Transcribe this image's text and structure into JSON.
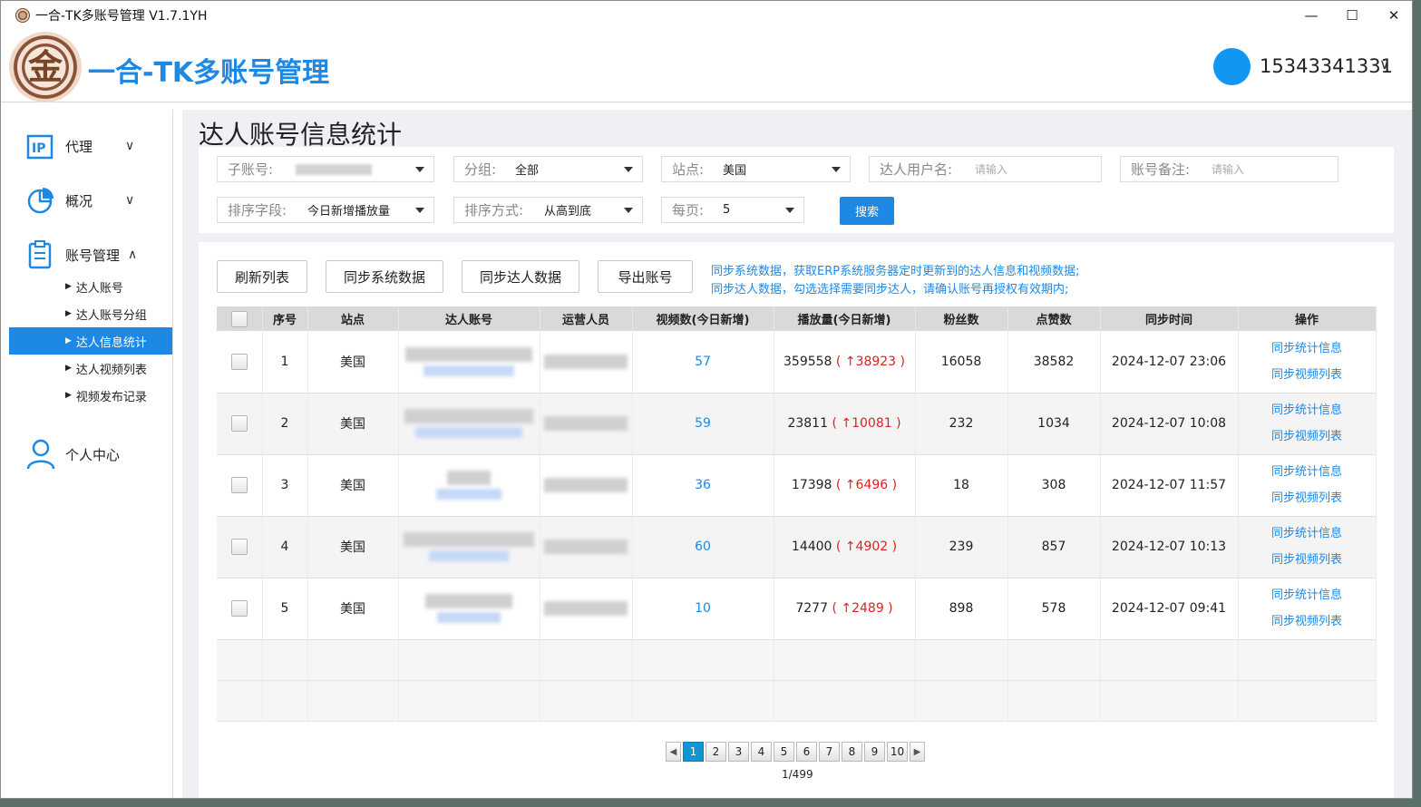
{
  "window": {
    "title": "一合-TK多账号管理 V1.7.1YH"
  },
  "header": {
    "brand": "一合-TK多账号管理",
    "user_phone": "15343341331"
  },
  "sidebar": {
    "items": [
      {
        "label": "代理",
        "icon": "ip-icon",
        "expanded": false
      },
      {
        "label": "概况",
        "icon": "pie-chart-icon",
        "expanded": false
      },
      {
        "label": "账号管理",
        "icon": "clipboard-icon",
        "expanded": true
      },
      {
        "label": "个人中心",
        "icon": "user-icon"
      }
    ],
    "sub_items": [
      "达人账号",
      "达人账号分组",
      "达人信息统计",
      "达人视频列表",
      "视频发布记录"
    ],
    "active_sub": "达人信息统计"
  },
  "page": {
    "title": "达人账号信息统计"
  },
  "filters": {
    "sub_account": {
      "label": "子账号:"
    },
    "group": {
      "label": "分组:",
      "value": "全部"
    },
    "site": {
      "label": "站点:",
      "value": "美国"
    },
    "creator_name": {
      "label": "达人用户名:",
      "placeholder": "请输入"
    },
    "account_note": {
      "label": "账号备注:",
      "placeholder": "请输入"
    },
    "sort_field": {
      "label": "排序字段:",
      "value": "今日新增播放量"
    },
    "sort_order": {
      "label": "排序方式:",
      "value": "从高到底"
    },
    "per_page": {
      "label": "每页:",
      "value": "5"
    },
    "search_label": "搜索"
  },
  "toolbar": {
    "refresh": "刷新列表",
    "sync_system": "同步系统数据",
    "sync_creator": "同步达人数据",
    "export": "导出账号",
    "tip1": "同步系统数据，获取ERP系统服务器定时更新到的达人信息和视频数据;",
    "tip2": "同步达人数据，勾选选择需要同步达人，请确认账号再授权有效期内;"
  },
  "table": {
    "columns": [
      "序号",
      "站点",
      "达人账号",
      "运营人员",
      "视频数(今日新增)",
      "播放量(今日新增)",
      "粉丝数",
      "点赞数",
      "同步时间",
      "操作"
    ],
    "rows": [
      {
        "no": "1",
        "site": "美国",
        "videos": "57",
        "plays": "359558",
        "plays_inc": "( ↑38923 )",
        "fans": "16058",
        "likes": "38582",
        "sync_time": "2024-12-07 23:06"
      },
      {
        "no": "2",
        "site": "美国",
        "videos": "59",
        "plays": "23811",
        "plays_inc": "( ↑10081 )",
        "fans": "232",
        "likes": "1034",
        "sync_time": "2024-12-07 10:08"
      },
      {
        "no": "3",
        "site": "美国",
        "videos": "36",
        "plays": "17398",
        "plays_inc": "( ↑6496 )",
        "fans": "18",
        "likes": "308",
        "sync_time": "2024-12-07 11:57"
      },
      {
        "no": "4",
        "site": "美国",
        "videos": "60",
        "plays": "14400",
        "plays_inc": "( ↑4902 )",
        "fans": "239",
        "likes": "857",
        "sync_time": "2024-12-07 10:13"
      },
      {
        "no": "5",
        "site": "美国",
        "videos": "10",
        "plays": "7277",
        "plays_inc": "( ↑2489 )",
        "fans": "898",
        "likes": "578",
        "sync_time": "2024-12-07 09:41"
      }
    ],
    "op_sync_stats": "同步统计信息",
    "op_sync_videos": "同步视频列表"
  },
  "pagination": {
    "pages": [
      "1",
      "2",
      "3",
      "4",
      "5",
      "6",
      "7",
      "8",
      "9",
      "10"
    ],
    "current": "1",
    "info": "1/499"
  },
  "colors": {
    "accent": "#1e88e5",
    "increase": "#e02020",
    "active_page": "#1296d3"
  }
}
